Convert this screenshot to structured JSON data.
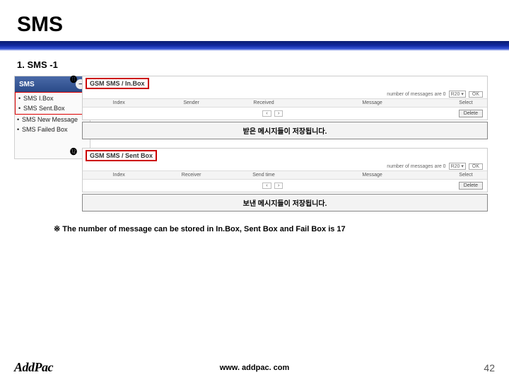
{
  "slide": {
    "title": "SMS",
    "section": "1. SMS -1",
    "footnote_prefix": "※",
    "footnote": "The number of message can be stored in In.Box, Sent Box and Fail Box is 17",
    "logo": "AddPac",
    "url": "www. addpac. com",
    "page": "42"
  },
  "nav": {
    "header": "SMS",
    "items": [
      "SMS I.Box",
      "SMS Sent.Box",
      "SMS New Message",
      "SMS Failed Box"
    ]
  },
  "panel1": {
    "badge": "⓫",
    "title": "GSM SMS / In.Box",
    "status": "number of messages are 0",
    "range": "R20 ▾",
    "ok": "OK",
    "columns": [
      "Index",
      "Sender",
      "Received",
      "Message",
      "Select"
    ],
    "page_prev": "‹",
    "page_next": "›",
    "delete": "Delete",
    "annotation": "받은 메시지들이 저장됩니다."
  },
  "panel2": {
    "badge": "⓬",
    "title": "GSM SMS / Sent Box",
    "status": "number of messages are 0",
    "range": "R20 ▾",
    "ok": "OK",
    "columns": [
      "Index",
      "Receiver",
      "Send time",
      "Message",
      "Select"
    ],
    "page_prev": "‹",
    "page_next": "›",
    "delete": "Delete",
    "annotation": "보낸 메시지들이 저장됩니다."
  }
}
